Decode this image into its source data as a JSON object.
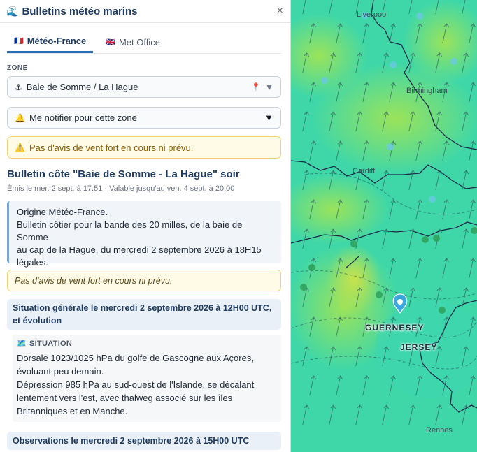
{
  "header": {
    "icon": "🌊",
    "title": "Bulletins météo marins",
    "close": "×"
  },
  "tabs": [
    {
      "flag": "🇫🇷",
      "label": "Météo-France"
    },
    {
      "flag": "🇬🇧",
      "label": "Met Office"
    }
  ],
  "zone": {
    "label": "ZONE",
    "icon": "⚓",
    "selected": "Baie de Somme / La Hague",
    "pin_icon": "📍",
    "arrow": "▼"
  },
  "notify": {
    "icon": "🔔",
    "label": "Me notifier pour cette zone",
    "arrow": "▼"
  },
  "alert": {
    "icon": "⚠️",
    "text": "Pas d'avis de vent fort en cours ni prévu."
  },
  "bulletin": {
    "title": "Bulletin côte \"Baie de Somme - La Hague\" soir",
    "meta": "Émis le mer. 2 sept. à 17:51 · Valable jusqu'au ven. 4 sept. à 20:00",
    "info_lines": [
      "Origine Météo-France.",
      "Bulletin côtier pour la bande des 20 milles, de la baie de Somme",
      "au cap de la Hague, du mercredi 2 septembre 2026 à 18H15",
      "légales."
    ],
    "note": "Pas d'avis de vent fort en cours ni prévu."
  },
  "sections": {
    "situation_head": "Situation générale le mercredi 2 septembre 2026 à 12H00 UTC, et évolution",
    "situation_label": "SITUATION",
    "situation_icon": "🗺️",
    "situation_lines": [
      "Dorsale 1023/1025 hPa du golfe de Gascogne aux Açores,",
      "évoluant peu demain.",
      "Dépression 985 hPa au sud-ouest de l'Islande, se décalant",
      "lentement vers l'est, avec thalweg associé sur les îles",
      "Britanniques et en Manche."
    ],
    "observations_head": "Observations le mercredi 2 septembre 2026 à 15H00 UTC"
  },
  "map": {
    "labels": {
      "liverpool": "Liverpool",
      "birmingham": "Birmingham",
      "cardiff": "Cardiff",
      "guernesey": "GUERNESEY",
      "jersey": "JERSEY",
      "rennes": "Rennes"
    },
    "colors": {
      "sea": "#3fd7a8",
      "land_green": "#8ee05a",
      "coast": "#1b2a4a",
      "marker": "#3ba7e0"
    }
  }
}
